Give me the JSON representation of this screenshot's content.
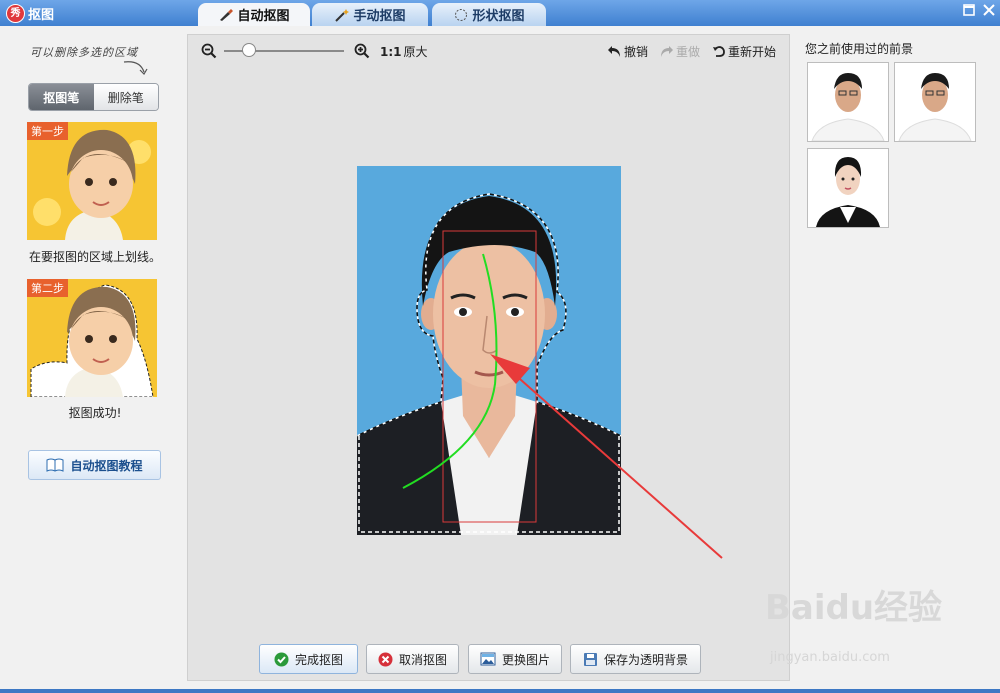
{
  "window": {
    "title": "抠图",
    "app_icon": "秀"
  },
  "tabs": [
    {
      "label": "自动抠图",
      "active": true,
      "icon": "brush-icon"
    },
    {
      "label": "手动抠图",
      "active": false,
      "icon": "magic-wand-icon"
    },
    {
      "label": "形状抠图",
      "active": false,
      "icon": "shape-icon"
    }
  ],
  "left": {
    "hint": "可以删除多选的区域",
    "pen_tool": "抠图笔",
    "erase_tool": "删除笔",
    "step1_tag": "第一步",
    "step1_caption": "在要抠图的区域上划线。",
    "step2_tag": "第二步",
    "step2_caption": "抠图成功!",
    "tutorial_button": "自动抠图教程"
  },
  "toolbar": {
    "ratio_label": "1:1",
    "original_label": "原大",
    "undo_label": "撤销",
    "redo_label": "重做",
    "reset_label": "重新开始",
    "zoom_value": 0.2
  },
  "bottom_buttons": {
    "finish": "完成抠图",
    "cancel": "取消抠图",
    "replace": "更换图片",
    "save_transparent": "保存为透明背景"
  },
  "right": {
    "recent_label": "您之前使用过的前景"
  },
  "watermark": {
    "brand": "Baidu经验",
    "url": "jingyan.baidu.com"
  },
  "colors": {
    "titlebar": "#3f80d0",
    "photo_bg": "#58a9dd",
    "stroke_green": "#22dd22",
    "arrow_red": "#e83a3a"
  }
}
